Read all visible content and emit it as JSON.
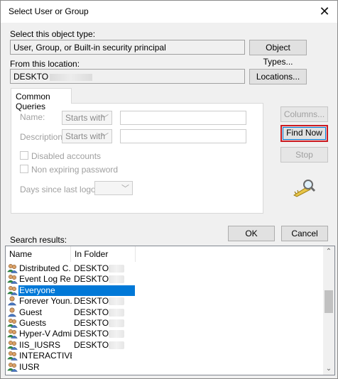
{
  "window": {
    "title": "Select User or Group",
    "close_glyph": "✕"
  },
  "object_type": {
    "label": "Select this object type:",
    "value": "User, Group, or Built-in security principal",
    "button": "Object Types..."
  },
  "location": {
    "label": "From this location:",
    "value": "DESKTO",
    "button": "Locations..."
  },
  "queries": {
    "tab": "Common Queries",
    "name_label": "Name:",
    "name_mode": "Starts with",
    "description_label": "Description:",
    "description_mode": "Starts with",
    "disabled_accounts": "Disabled accounts",
    "non_expiring_password": "Non expiring password",
    "days_label": "Days since last logon:",
    "combo_chevron": "﹀"
  },
  "actions": {
    "columns": "Columns...",
    "find_now": "Find Now",
    "stop": "Stop",
    "ok": "OK",
    "cancel": "Cancel",
    "search_icon": "key-magnifier-icon"
  },
  "results": {
    "label": "Search results:",
    "columns": [
      "Name",
      "In Folder"
    ],
    "rows": [
      {
        "name": "Distributed C...",
        "folder": "DESKTOP-",
        "icon": "group-icon"
      },
      {
        "name": "Event Log Re...",
        "folder": "DESKTOP-",
        "icon": "group-icon"
      },
      {
        "name": "Everyone",
        "folder": "",
        "icon": "group-icon",
        "selected": true
      },
      {
        "name": "Forever Youn...",
        "folder": "DESKTOP-",
        "icon": "user-icon"
      },
      {
        "name": "Guest",
        "folder": "DESKTOP-",
        "icon": "user-icon"
      },
      {
        "name": "Guests",
        "folder": "DESKTOP-",
        "icon": "group-icon"
      },
      {
        "name": "Hyper-V Admi...",
        "folder": "DESKTOP-",
        "icon": "group-icon"
      },
      {
        "name": "IIS_IUSRS",
        "folder": "DESKTOP-",
        "icon": "group-icon"
      },
      {
        "name": "INTERACTIVE",
        "folder": "",
        "icon": "group-icon"
      },
      {
        "name": "IUSR",
        "folder": "",
        "icon": "group-icon"
      }
    ],
    "scroll_up": "⌃",
    "scroll_down": "⌄"
  },
  "colors": {
    "accent": "#0078d7",
    "default_button_border": "#cc1b22"
  }
}
